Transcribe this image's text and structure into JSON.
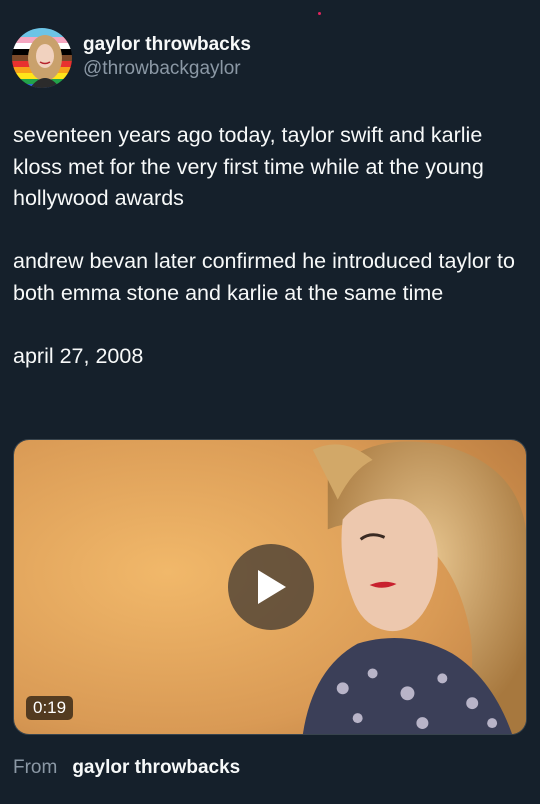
{
  "author": {
    "display_name": "gaylor throwbacks",
    "handle": "@throwbackgaylor"
  },
  "tweet": {
    "paragraphs": [
      "seventeen years ago today, taylor swift and karlie kloss met for the very first time while at the young hollywood awards",
      "andrew bevan later confirmed he introduced taylor to both emma stone and karlie at the same time",
      "april 27, 2008"
    ]
  },
  "media": {
    "type": "video",
    "duration": "0:19",
    "play_icon": "play-icon"
  },
  "footer": {
    "from_label": "From",
    "source_name": "gaylor throwbacks"
  },
  "colors": {
    "background": "#15202b",
    "primary_text": "#f7f9f9",
    "secondary_text": "#8b98a5"
  }
}
